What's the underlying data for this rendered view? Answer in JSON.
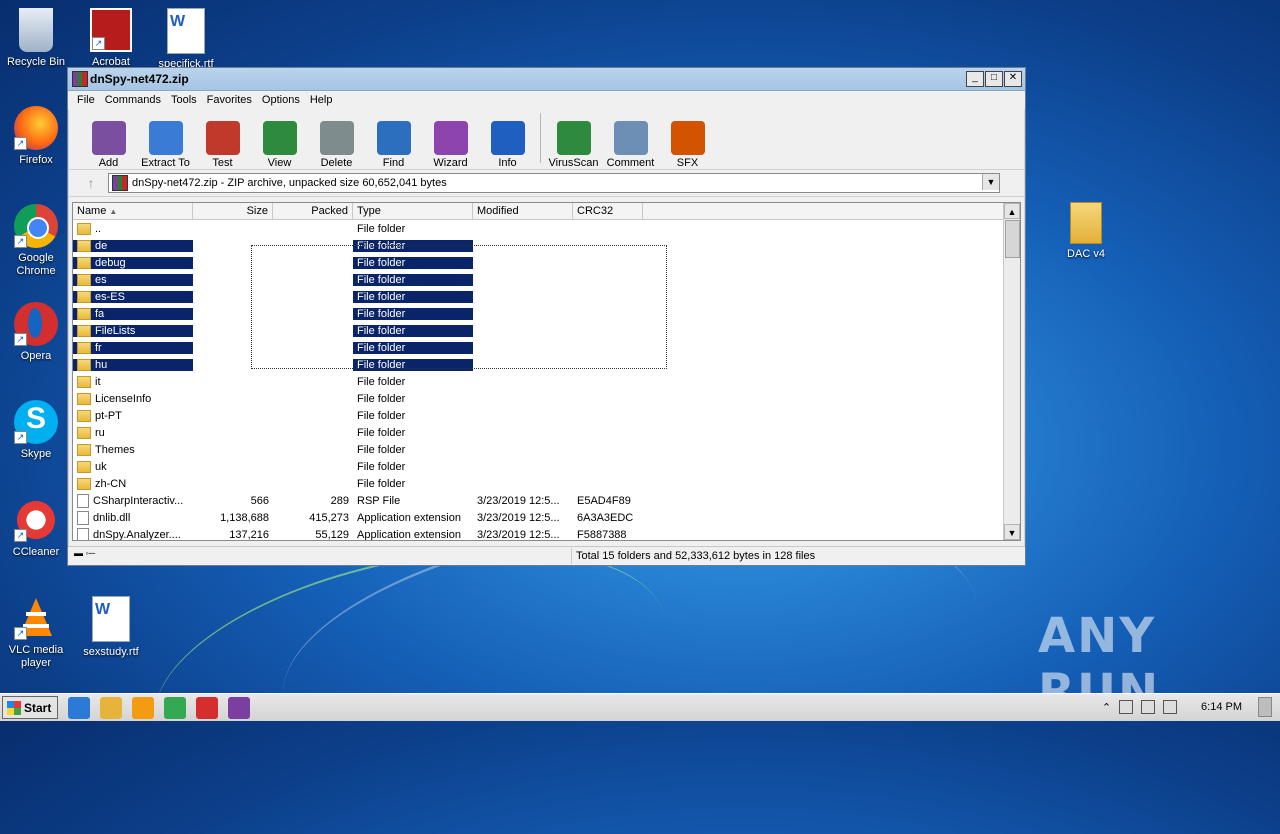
{
  "desktop": {
    "icons": [
      {
        "label": "Recycle Bin",
        "icon": "recycle-bin-icon"
      },
      {
        "label": "Acrobat",
        "icon": "acrobat-icon"
      },
      {
        "label": "specifick.rtf",
        "icon": "word-document-icon"
      },
      {
        "label": "Firefox",
        "icon": "firefox-icon"
      },
      {
        "label": "Google Chrome",
        "icon": "chrome-icon"
      },
      {
        "label": "Opera",
        "icon": "opera-icon"
      },
      {
        "label": "Skype",
        "icon": "skype-icon"
      },
      {
        "label": "CCleaner",
        "icon": "ccleaner-icon"
      },
      {
        "label": "VLC media player",
        "icon": "vlc-icon"
      },
      {
        "label": "sexstudy.rtf",
        "icon": "word-document-icon"
      },
      {
        "label": "DAC v4",
        "icon": "folder-icon"
      }
    ],
    "watermark": "ANY RUN"
  },
  "window": {
    "title": "dnSpy-net472.zip",
    "menu": [
      "File",
      "Commands",
      "Tools",
      "Favorites",
      "Options",
      "Help"
    ],
    "toolbar": [
      {
        "label": "Add",
        "icon": "add-archive-icon",
        "color": "#7a4fa0"
      },
      {
        "label": "Extract To",
        "icon": "extract-folder-icon",
        "color": "#3a7bd5"
      },
      {
        "label": "Test",
        "icon": "test-checklist-icon",
        "color": "#c0392b"
      },
      {
        "label": "View",
        "icon": "view-book-icon",
        "color": "#2e8b3d"
      },
      {
        "label": "Delete",
        "icon": "trash-icon",
        "color": "#7f8c8d"
      },
      {
        "label": "Find",
        "icon": "magnifier-icon",
        "color": "#2c6fbf"
      },
      {
        "label": "Wizard",
        "icon": "wand-icon",
        "color": "#8e44ad"
      },
      {
        "label": "Info",
        "icon": "info-icon",
        "color": "#1f5fbf"
      },
      {
        "label": "VirusScan",
        "icon": "virus-scan-icon",
        "color": "#2e8b3d"
      },
      {
        "label": "Comment",
        "icon": "comment-icon",
        "color": "#6d8fb5"
      },
      {
        "label": "SFX",
        "icon": "sfx-box-icon",
        "color": "#d35400"
      }
    ],
    "address": "dnSpy-net472.zip - ZIP archive, unpacked size 60,652,041 bytes",
    "columns": [
      "Name",
      "Size",
      "Packed",
      "Type",
      "Modified",
      "CRC32"
    ],
    "rows": [
      {
        "name": "..",
        "size": "",
        "packed": "",
        "type": "File folder",
        "modified": "",
        "crc": "",
        "kind": "folder",
        "selected": false
      },
      {
        "name": "de",
        "size": "",
        "packed": "",
        "type": "File folder",
        "modified": "",
        "crc": "",
        "kind": "folder",
        "selected": true
      },
      {
        "name": "debug",
        "size": "",
        "packed": "",
        "type": "File folder",
        "modified": "",
        "crc": "",
        "kind": "folder",
        "selected": true
      },
      {
        "name": "es",
        "size": "",
        "packed": "",
        "type": "File folder",
        "modified": "",
        "crc": "",
        "kind": "folder",
        "selected": true
      },
      {
        "name": "es-ES",
        "size": "",
        "packed": "",
        "type": "File folder",
        "modified": "",
        "crc": "",
        "kind": "folder",
        "selected": true
      },
      {
        "name": "fa",
        "size": "",
        "packed": "",
        "type": "File folder",
        "modified": "",
        "crc": "",
        "kind": "folder",
        "selected": true
      },
      {
        "name": "FileLists",
        "size": "",
        "packed": "",
        "type": "File folder",
        "modified": "",
        "crc": "",
        "kind": "folder",
        "selected": true
      },
      {
        "name": "fr",
        "size": "",
        "packed": "",
        "type": "File folder",
        "modified": "",
        "crc": "",
        "kind": "folder",
        "selected": true
      },
      {
        "name": "hu",
        "size": "",
        "packed": "",
        "type": "File folder",
        "modified": "",
        "crc": "",
        "kind": "folder",
        "selected": true
      },
      {
        "name": "it",
        "size": "",
        "packed": "",
        "type": "File folder",
        "modified": "",
        "crc": "",
        "kind": "folder",
        "selected": false
      },
      {
        "name": "LicenseInfo",
        "size": "",
        "packed": "",
        "type": "File folder",
        "modified": "",
        "crc": "",
        "kind": "folder",
        "selected": false
      },
      {
        "name": "pt-PT",
        "size": "",
        "packed": "",
        "type": "File folder",
        "modified": "",
        "crc": "",
        "kind": "folder",
        "selected": false
      },
      {
        "name": "ru",
        "size": "",
        "packed": "",
        "type": "File folder",
        "modified": "",
        "crc": "",
        "kind": "folder",
        "selected": false
      },
      {
        "name": "Themes",
        "size": "",
        "packed": "",
        "type": "File folder",
        "modified": "",
        "crc": "",
        "kind": "folder",
        "selected": false
      },
      {
        "name": "uk",
        "size": "",
        "packed": "",
        "type": "File folder",
        "modified": "",
        "crc": "",
        "kind": "folder",
        "selected": false
      },
      {
        "name": "zh-CN",
        "size": "",
        "packed": "",
        "type": "File folder",
        "modified": "",
        "crc": "",
        "kind": "folder",
        "selected": false
      },
      {
        "name": "CSharpInteractiv...",
        "size": "566",
        "packed": "289",
        "type": "RSP File",
        "modified": "3/23/2019 12:5...",
        "crc": "E5AD4F89",
        "kind": "file",
        "selected": false
      },
      {
        "name": "dnlib.dll",
        "size": "1,138,688",
        "packed": "415,273",
        "type": "Application extension",
        "modified": "3/23/2019 12:5...",
        "crc": "6A3A3EDC",
        "kind": "dll",
        "selected": false
      },
      {
        "name": "dnSpy.Analyzer....",
        "size": "137,216",
        "packed": "55,129",
        "type": "Application extension",
        "modified": "3/23/2019 12:5...",
        "crc": "F5887388",
        "kind": "dll",
        "selected": false
      }
    ],
    "status": "Total 15 folders and 52,333,612 bytes in 128 files"
  },
  "taskbar": {
    "start_label": "Start",
    "apps": [
      {
        "icon": "internet-explorer-icon",
        "color": "#2b7bd6"
      },
      {
        "icon": "explorer-folder-icon",
        "color": "#e6b43a"
      },
      {
        "icon": "media-player-icon",
        "color": "#f39c12"
      },
      {
        "icon": "chrome-icon",
        "color": "#34a853"
      },
      {
        "icon": "opera-icon",
        "color": "#d32f2f"
      },
      {
        "icon": "winrar-icon",
        "color": "#7b3fa0"
      }
    ],
    "clock": "6:14 PM"
  }
}
